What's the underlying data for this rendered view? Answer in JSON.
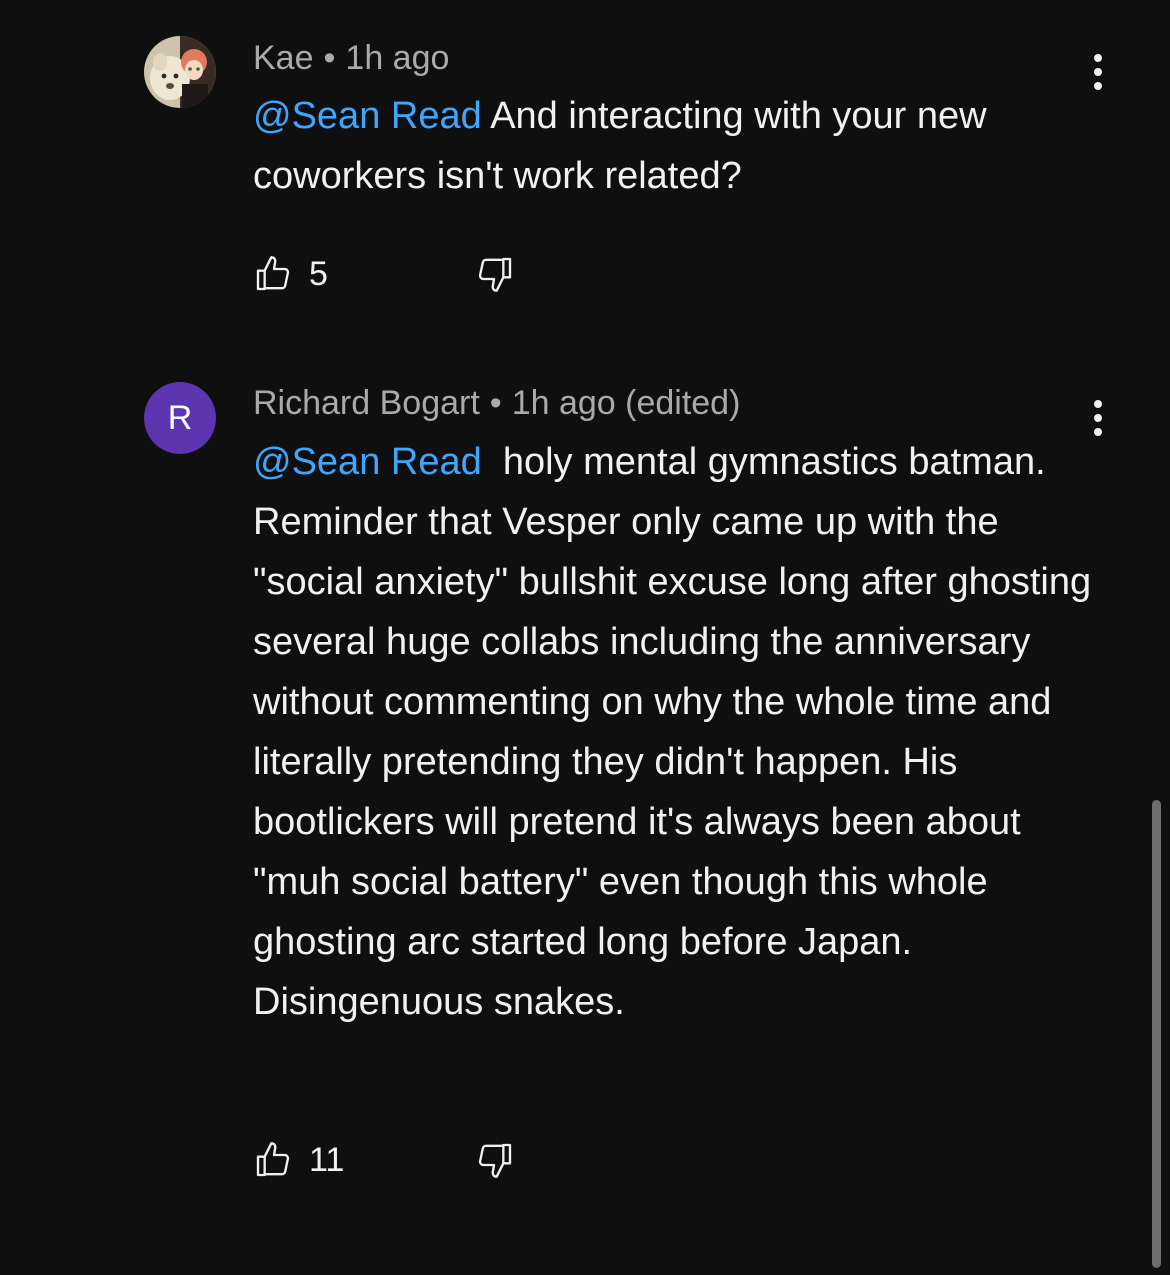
{
  "comments": [
    {
      "author": "Kae",
      "separator": "•",
      "time": "1h ago",
      "mention": "@Sean Read",
      "text": " And interacting with your new coworkers isn't work related?",
      "likes": "5",
      "avatar": {
        "type": "image",
        "bg": "#d9cdb8"
      }
    },
    {
      "author": "Richard Bogart",
      "separator": "•",
      "time": "1h ago (edited)",
      "mention": "@Sean Read",
      "text": "  holy mental gymnastics batman. Reminder that Vesper only came up with the \"social anxiety\" bullshit excuse long after ghosting several huge collabs including the anniversary without commenting on why the whole time and literally pretending they didn't happen. His bootlickers will pretend it's always been about \"muh social battery\" even though this whole ghosting arc started long before Japan. Disingenuous snakes.",
      "likes": "11",
      "avatar": {
        "type": "letter",
        "letter": "R",
        "bg": "#5e35b1"
      }
    }
  ],
  "colors": {
    "background": "#0f0f0f",
    "mention": "#3ea6ff",
    "meta_text": "#aaaaaa",
    "body_text": "#f1f1f1"
  }
}
